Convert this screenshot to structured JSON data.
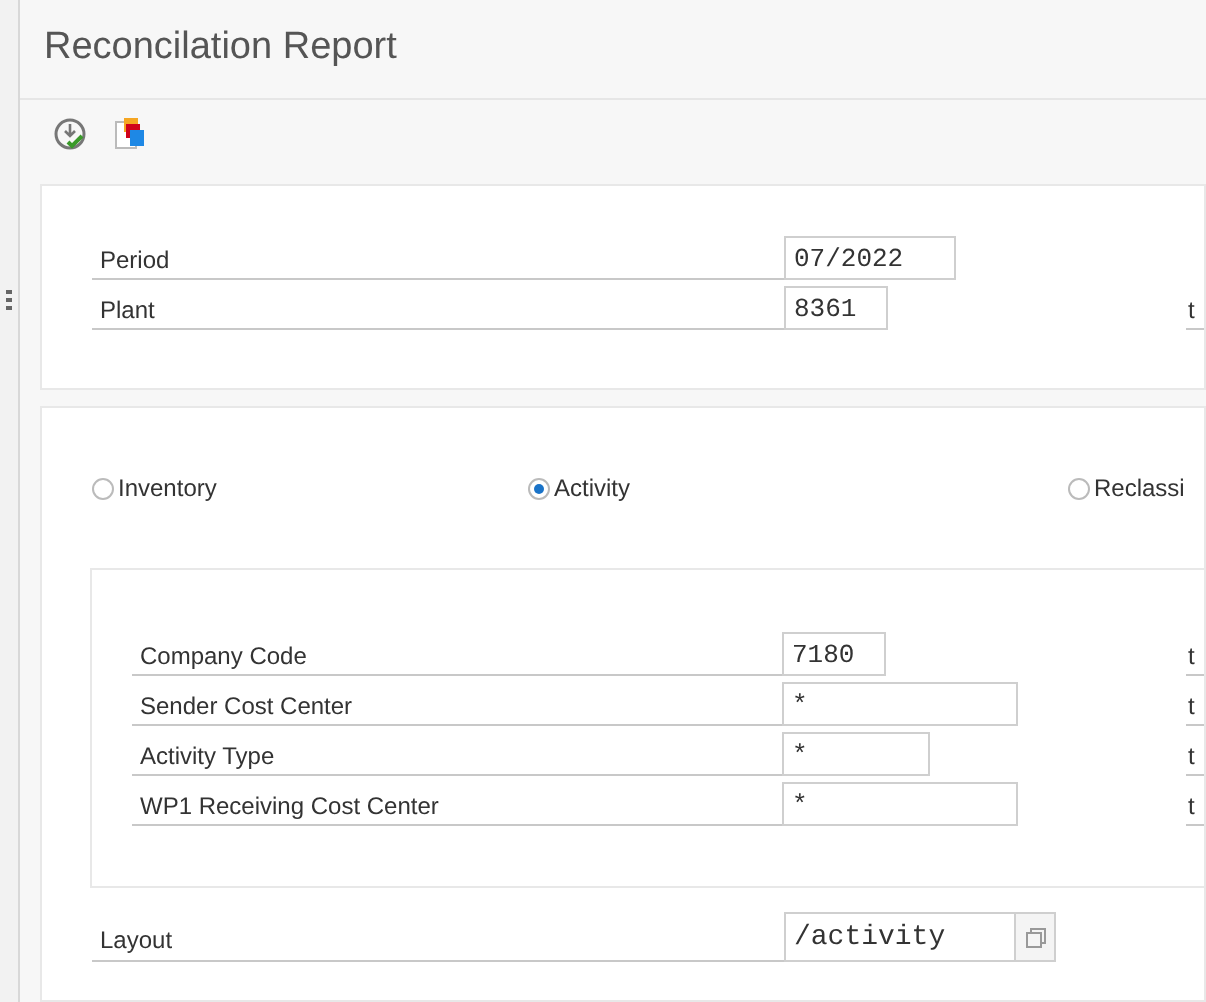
{
  "window": {
    "title": "Reconcilation Report"
  },
  "toolbar": [
    {
      "kind": "execute"
    },
    {
      "kind": "variants"
    }
  ],
  "header_fields": [
    {
      "label": "Period",
      "value": "07/2022"
    },
    {
      "label": "Plant",
      "value": "8361",
      "suffix": "t"
    }
  ],
  "report_types": [
    {
      "label": "Inventory",
      "selected": false
    },
    {
      "label": "Activity",
      "selected": true
    },
    {
      "label": "Reclassi",
      "selected": false
    }
  ],
  "activity_fields": [
    {
      "label": "Company Code",
      "value": "7180",
      "suffix": "t"
    },
    {
      "label": "Sender Cost Center",
      "value": "*",
      "suffix": "t"
    },
    {
      "label": "Activity Type",
      "value": "*",
      "suffix": "t"
    },
    {
      "label": "WP1 Receiving Cost Center",
      "value": "*",
      "suffix": "t"
    }
  ],
  "layout": {
    "label": "Layout",
    "value": "/activity"
  }
}
